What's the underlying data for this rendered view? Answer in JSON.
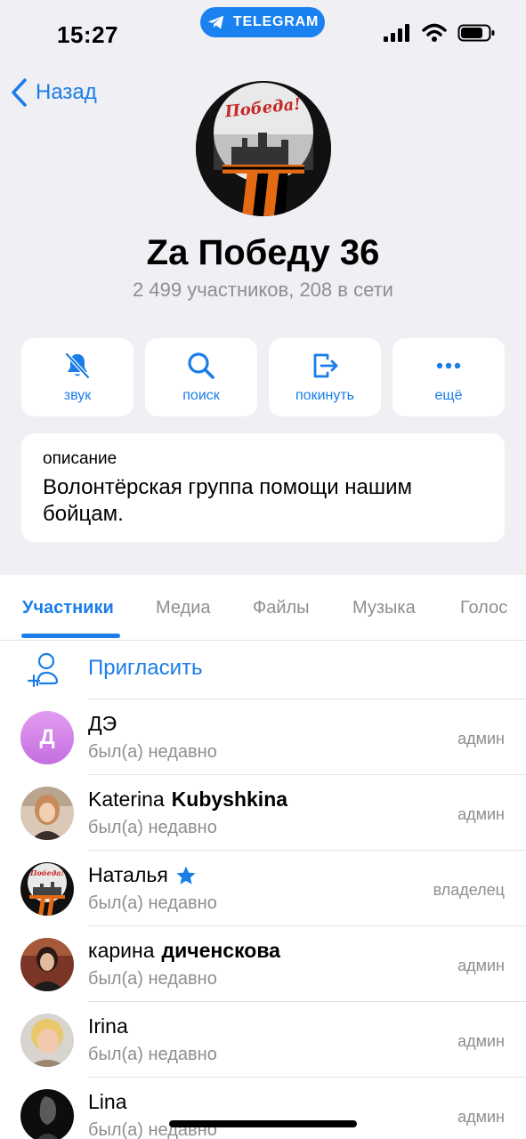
{
  "status_bar": {
    "time": "15:27",
    "pill_label": "TELEGRAM"
  },
  "nav": {
    "back_label": "Назад"
  },
  "group": {
    "title": "Za Победу 36",
    "subtitle": "2 499 участников, 208 в сети",
    "avatar_text": "Победа!"
  },
  "actions": [
    {
      "label": "звук",
      "icon": "bell-slash-icon"
    },
    {
      "label": "поиск",
      "icon": "search-icon"
    },
    {
      "label": "покинуть",
      "icon": "leave-icon"
    },
    {
      "label": "ещё",
      "icon": "more-icon"
    }
  ],
  "description": {
    "label": "описание",
    "text": "Волонтёрская группа помощи нашим бойцам."
  },
  "tabs": [
    "Участники",
    "Медиа",
    "Файлы",
    "Музыка",
    "Голос"
  ],
  "invite": {
    "label": "Пригласить"
  },
  "members": [
    {
      "first": "ДЭ",
      "last": "",
      "status": "был(а) недавно",
      "role": "админ",
      "initial": "Д"
    },
    {
      "first": "Katerina",
      "last": "Kubyshkina",
      "status": "был(а) недавно",
      "role": "админ"
    },
    {
      "first": "Наталья",
      "last": "",
      "status": "был(а) недавно",
      "role": "владелец"
    },
    {
      "first": "карина",
      "last": "диченскова",
      "status": "был(а) недавно",
      "role": "админ"
    },
    {
      "first": "Irina",
      "last": "",
      "status": "был(а) недавно",
      "role": "админ"
    },
    {
      "first": "Lina",
      "last": "",
      "status": "был(а) недавно",
      "role": "админ"
    }
  ],
  "colors": {
    "accent": "#1a7de8",
    "pill": "#1a82f0",
    "background": "#efeff4",
    "secondary_text": "#8e8e93"
  }
}
